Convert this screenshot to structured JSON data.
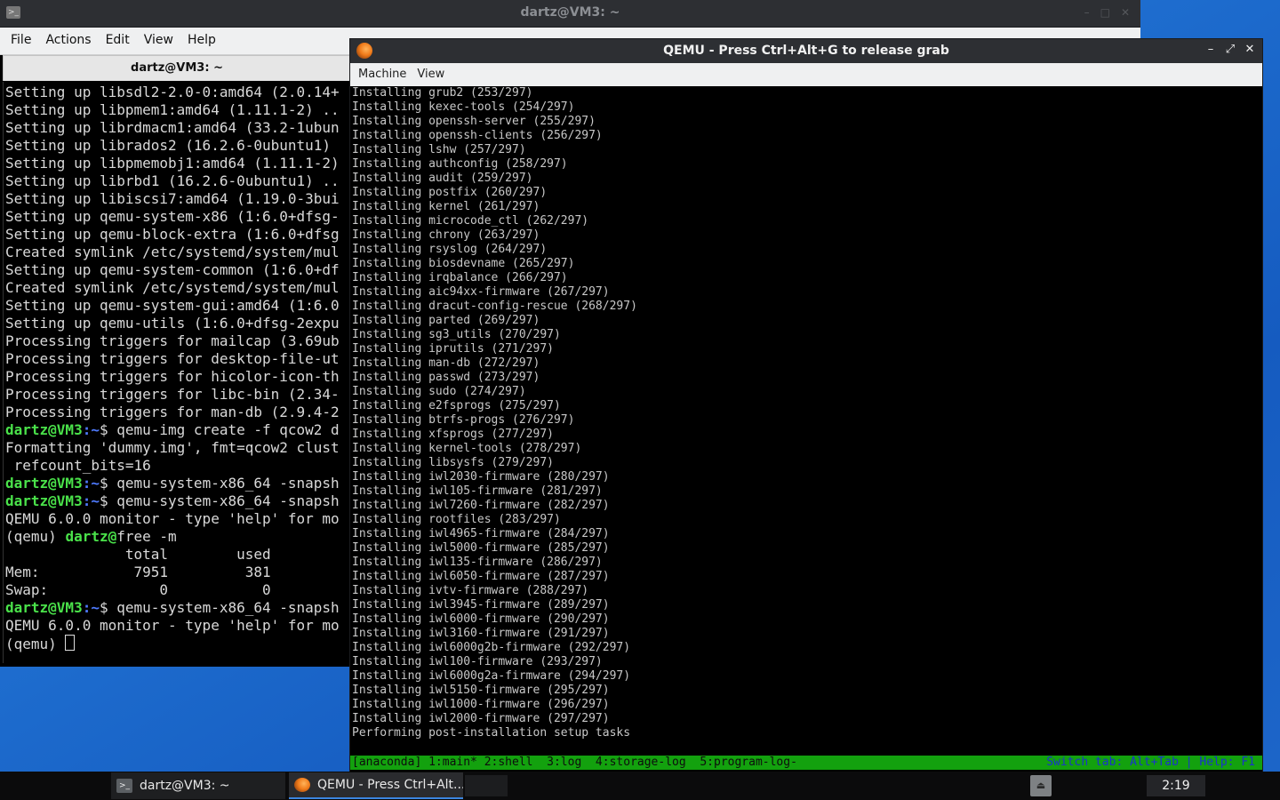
{
  "terminal": {
    "window_title": "dartz@VM3: ~",
    "menu": [
      "File",
      "Actions",
      "Edit",
      "View",
      "Help"
    ],
    "tab_title": "dartz@VM3: ~",
    "prompt_user": "dartz@VM3",
    "prompt_path": ":~",
    "lines": [
      "Setting up libsdl2-2.0-0:amd64 (2.0.14+",
      "Setting up libpmem1:amd64 (1.11.1-2) ..",
      "Setting up librdmacm1:amd64 (33.2-1ubun",
      "Setting up librados2 (16.2.6-0ubuntu1)",
      "Setting up libpmemobj1:amd64 (1.11.1-2)",
      "Setting up librbd1 (16.2.6-0ubuntu1) ..",
      "Setting up libiscsi7:amd64 (1.19.0-3bui",
      "Setting up qemu-system-x86 (1:6.0+dfsg-",
      "Setting up qemu-block-extra (1:6.0+dfsg",
      "Created symlink /etc/systemd/system/mul",
      "Setting up qemu-system-common (1:6.0+df",
      "Created symlink /etc/systemd/system/mul",
      "Setting up qemu-system-gui:amd64 (1:6.0",
      "Setting up qemu-utils (1:6.0+dfsg-2expu",
      "Processing triggers for mailcap (3.69ub",
      "Processing triggers for desktop-file-ut",
      "Processing triggers for hicolor-icon-th",
      "Processing triggers for libc-bin (2.34-",
      "Processing triggers for man-db (2.9.4-2"
    ],
    "cmd1": "$ qemu-img create -f qcow2 d",
    "format_line": "Formatting 'dummy.img', fmt=qcow2 clust",
    "refcount_line": " refcount_bits=16",
    "cmd2": "$ qemu-system-x86_64 -snapsh",
    "cmd3": "$ qemu-system-x86_64 -snapsh",
    "monitor_line1": "QEMU 6.0.0 monitor - type 'help' for mo",
    "qemu_prompt_prefix": "(qemu) ",
    "qemu_prompt_user": "dartz@",
    "free_cmd": "free -m",
    "free_header": "              total        used",
    "free_mem": "Mem:           7951         381",
    "free_swap": "Swap:             0           0",
    "cmd4": "$ qemu-system-x86_64 -snapsh",
    "monitor_line2": "QEMU 6.0.0 monitor - type 'help' for mo",
    "last_prompt": "(qemu) "
  },
  "qemu": {
    "window_title": "QEMU - Press Ctrl+Alt+G to release grab",
    "menu": [
      "Machine",
      "View"
    ],
    "console_lines": [
      "Installing grub2 (253/297)",
      "Installing kexec-tools (254/297)",
      "Installing openssh-server (255/297)",
      "Installing openssh-clients (256/297)",
      "Installing lshw (257/297)",
      "Installing authconfig (258/297)",
      "Installing audit (259/297)",
      "Installing postfix (260/297)",
      "Installing kernel (261/297)",
      "Installing microcode_ctl (262/297)",
      "Installing chrony (263/297)",
      "Installing rsyslog (264/297)",
      "Installing biosdevname (265/297)",
      "Installing irqbalance (266/297)",
      "Installing aic94xx-firmware (267/297)",
      "Installing dracut-config-rescue (268/297)",
      "Installing parted (269/297)",
      "Installing sg3_utils (270/297)",
      "Installing iprutils (271/297)",
      "Installing man-db (272/297)",
      "Installing passwd (273/297)",
      "Installing sudo (274/297)",
      "Installing e2fsprogs (275/297)",
      "Installing btrfs-progs (276/297)",
      "Installing xfsprogs (277/297)",
      "Installing kernel-tools (278/297)",
      "Installing libsysfs (279/297)",
      "Installing iwl2030-firmware (280/297)",
      "Installing iwl105-firmware (281/297)",
      "Installing iwl7260-firmware (282/297)",
      "Installing rootfiles (283/297)",
      "Installing iwl4965-firmware (284/297)",
      "Installing iwl5000-firmware (285/297)",
      "Installing iwl135-firmware (286/297)",
      "Installing iwl6050-firmware (287/297)",
      "Installing ivtv-firmware (288/297)",
      "Installing iwl3945-firmware (289/297)",
      "Installing iwl6000-firmware (290/297)",
      "Installing iwl3160-firmware (291/297)",
      "Installing iwl6000g2b-firmware (292/297)",
      "Installing iwl100-firmware (293/297)",
      "Installing iwl6000g2a-firmware (294/297)",
      "Installing iwl5150-firmware (295/297)",
      "Installing iwl1000-firmware (296/297)",
      "Installing iwl2000-firmware (297/297)",
      "Performing post-installation setup tasks"
    ],
    "status_left": "[anaconda] 1:main* 2:shell  3:log  4:storage-log  5:program-log-",
    "status_right": "Switch tab: Alt+Tab | Help: F1"
  },
  "taskbar": {
    "items": [
      {
        "label": "dartz@VM3: ~",
        "icon": "terminal-icon"
      },
      {
        "label": "QEMU - Press Ctrl+Alt...",
        "icon": "qemu-icon"
      }
    ],
    "clock": "2:19"
  },
  "colors": {
    "prompt_user": "#4ae24a",
    "prompt_path": "#4f7bff",
    "status_bar": "#13a10e",
    "desktop": "#1f6fd0"
  }
}
